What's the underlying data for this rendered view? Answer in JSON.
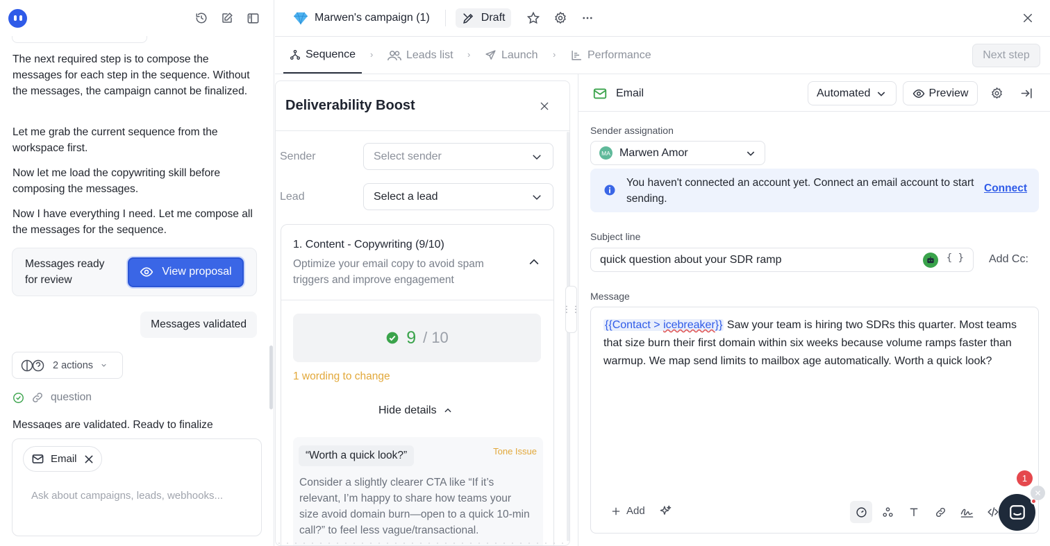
{
  "chat": {
    "messages": [
      "The next required step is to compose the messages for each step in the sequence. Without the messages, the campaign cannot be finalized.",
      "Let me grab the current sequence from the workspace first.",
      "Now let me load the copywriting skill before composing the messages.",
      "Now I have everything I need. Let me compose all the messages for the sequence."
    ],
    "proposal_text": "Messages ready for review",
    "view_proposal_label": "View proposal",
    "validated_text": "Messages validated",
    "actions_label": "2 actions",
    "question_label": "question",
    "trailing_text": "Messages are validated. Ready to finalize",
    "composer": {
      "chip_label": "Email",
      "placeholder": "Ask about campaigns, leads, webhooks..."
    }
  },
  "topbar": {
    "campaign_title": "Marwen's campaign (1)",
    "status_label": "Draft"
  },
  "steps": {
    "items": [
      "Sequence",
      "Leads list",
      "Launch",
      "Performance"
    ],
    "next_step_label": "Next step"
  },
  "deliverability": {
    "title": "Deliverability Boost",
    "sender_label": "Sender",
    "sender_placeholder": "Select sender",
    "lead_label": "Lead",
    "lead_value": "Select a lead",
    "section_title": "1. Content - Copywriting (9/10)",
    "section_subtitle": "Optimize your email copy to avoid spam triggers and improve engagement",
    "score": "9",
    "score_max": "/ 10",
    "wording_note": "1 wording to change",
    "hide_details_label": "Hide details",
    "issue": {
      "quote": "“Worth a quick look?”",
      "tag": "Tone Issue",
      "suggestion": "Consider a slightly clearer CTA like “If it’s relevant, I’m happy to share how teams your size avoid domain burn—open to a quick 10-min call?” to feel less vague/transactional."
    }
  },
  "email": {
    "title": "Email",
    "mode_label": "Automated",
    "preview_label": "Preview",
    "sender_assignation_label": "Sender assignation",
    "sender_initials": "MA",
    "sender_name": "Marwen Amor",
    "notice_text": "You haven't connected an account yet. Connect an email account to start sending.",
    "connect_label": "Connect",
    "subject_label": "Subject line",
    "subject_value": "quick question about your SDR ramp",
    "braces": "{ }",
    "add_cc_label": "Add Cc:",
    "message_label": "Message",
    "message_var_open": "{{Contact > ",
    "message_var_name": "icebreaker",
    "message_var_close": "}}",
    "message_body": " Saw your team is hiring two SDRs this quarter. Most teams that size burn their first domain within six weeks because volume ramps faster than warmup. We map send limits to mailbox age automatically. Worth a quick look?",
    "add_label": "Add"
  },
  "support": {
    "badge_count": "1"
  },
  "colors": {
    "accent": "#3a66e6",
    "success": "#3aa34b",
    "warning": "#e2a83a",
    "danger": "#e5484d",
    "info_bg": "#eef3fd"
  },
  "icons": [
    "logo-icon",
    "history-icon",
    "compose-icon",
    "sidebar-icon",
    "diamond-icon",
    "draft-icon",
    "star-icon",
    "settings-icon",
    "more-icon",
    "close-icon",
    "sequence-icon",
    "leads-icon",
    "launch-icon",
    "performance-icon",
    "eye-icon",
    "mail-icon",
    "chevron-down-icon",
    "chevron-up-icon",
    "check-circle-icon",
    "info-icon",
    "robot-icon",
    "plus-icon",
    "sparkle-icon",
    "link-icon",
    "code-icon"
  ]
}
